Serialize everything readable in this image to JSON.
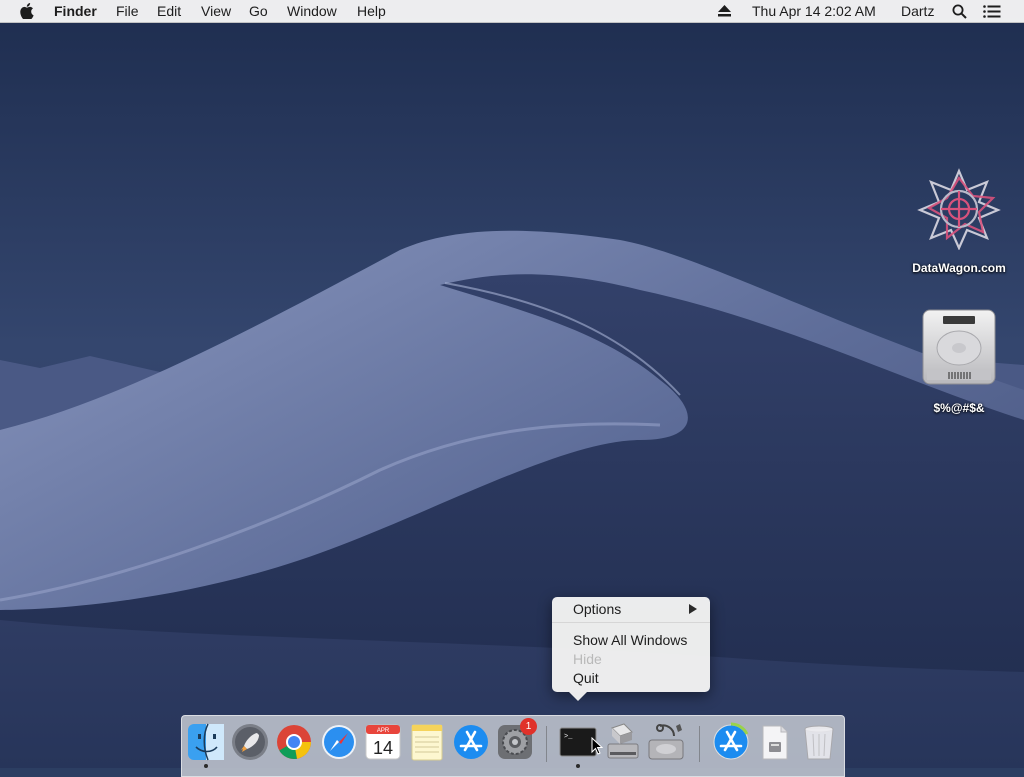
{
  "menubar": {
    "apple_icon": "apple-logo",
    "app_name": "Finder",
    "menus": [
      "File",
      "Edit",
      "View",
      "Go",
      "Window",
      "Help"
    ],
    "status": {
      "eject_icon": "eject-icon",
      "datetime": "Thu Apr 14  2:02 AM",
      "user": "Dartz",
      "search_icon": "spotlight-search-icon",
      "notification_icon": "notification-center-icon"
    }
  },
  "desktop": {
    "icons": [
      {
        "label": "DataWagon.com",
        "icon": "datawagon-star-logo"
      },
      {
        "label": "$%@#$&",
        "icon": "hard-drive-icon"
      }
    ]
  },
  "context_menu": {
    "items": [
      {
        "label": "Options",
        "submenu": true,
        "enabled": true
      },
      {
        "label": "Show All Windows",
        "enabled": true
      },
      {
        "label": "Hide",
        "enabled": false
      },
      {
        "label": "Quit",
        "enabled": true
      }
    ]
  },
  "dock": {
    "apps": [
      "finder-icon",
      "launchpad-icon",
      "chrome-icon",
      "safari-icon",
      "calendar-icon",
      "notes-icon",
      "app-store-icon",
      "system-preferences-icon",
      "terminal-icon",
      "boot-camp-assistant-icon",
      "disk-utility-icon",
      "app-store-download-icon",
      "downloads-stack-icon",
      "trash-icon"
    ],
    "calendar": {
      "month": "APR",
      "day": "14"
    },
    "system_preferences_badge": "1",
    "terminal_prompt": ">_"
  },
  "colors": {
    "sky_top": "#1f2f52",
    "sky_bottom": "#3b4a73",
    "dune": "#6a79a6",
    "menu_bar": "#f6f6f6",
    "badge": "#e0312a"
  }
}
